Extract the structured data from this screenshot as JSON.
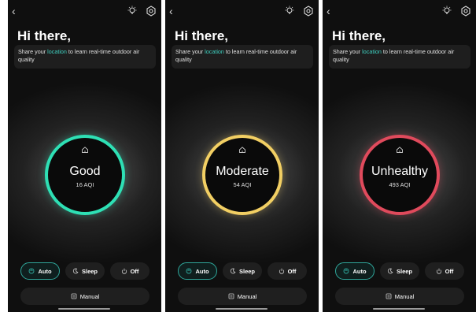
{
  "screens": [
    {
      "greeting": "Hi there,",
      "share_prefix": "Share your ",
      "share_link": "location",
      "share_suffix": " to learn real-time outdoor air quality",
      "status": "Good",
      "aqi": "16 AQI",
      "ring_color": "#2ee0b5",
      "modes": [
        "Auto",
        "Sleep",
        "Off"
      ],
      "active_mode": "Auto",
      "manual": "Manual"
    },
    {
      "greeting": "Hi there,",
      "share_prefix": "Share your ",
      "share_link": "location",
      "share_suffix": " to learn real-time outdoor air quality",
      "status": "Moderate",
      "aqi": "54 AQI",
      "ring_color": "#f2cf63",
      "modes": [
        "Auto",
        "Sleep",
        "Off"
      ],
      "active_mode": "Auto",
      "manual": "Manual"
    },
    {
      "greeting": "Hi there,",
      "share_prefix": "Share your ",
      "share_link": "location",
      "share_suffix": " to learn real-time outdoor air quality",
      "status": "Unhealthy",
      "aqi": "493 AQI",
      "ring_color": "#e04a5c",
      "modes": [
        "Auto",
        "Sleep",
        "Off"
      ],
      "active_mode": "Auto",
      "manual": "Manual"
    }
  ],
  "icons": {
    "back": "chevron-left-icon",
    "bulb": "lightbulb-icon",
    "settings": "gear-icon",
    "home": "home-icon",
    "auto": "auto-fan-icon",
    "sleep": "moon-icon",
    "off": "power-icon",
    "manual": "manual-icon"
  },
  "accent_color": "#3fd0c0"
}
